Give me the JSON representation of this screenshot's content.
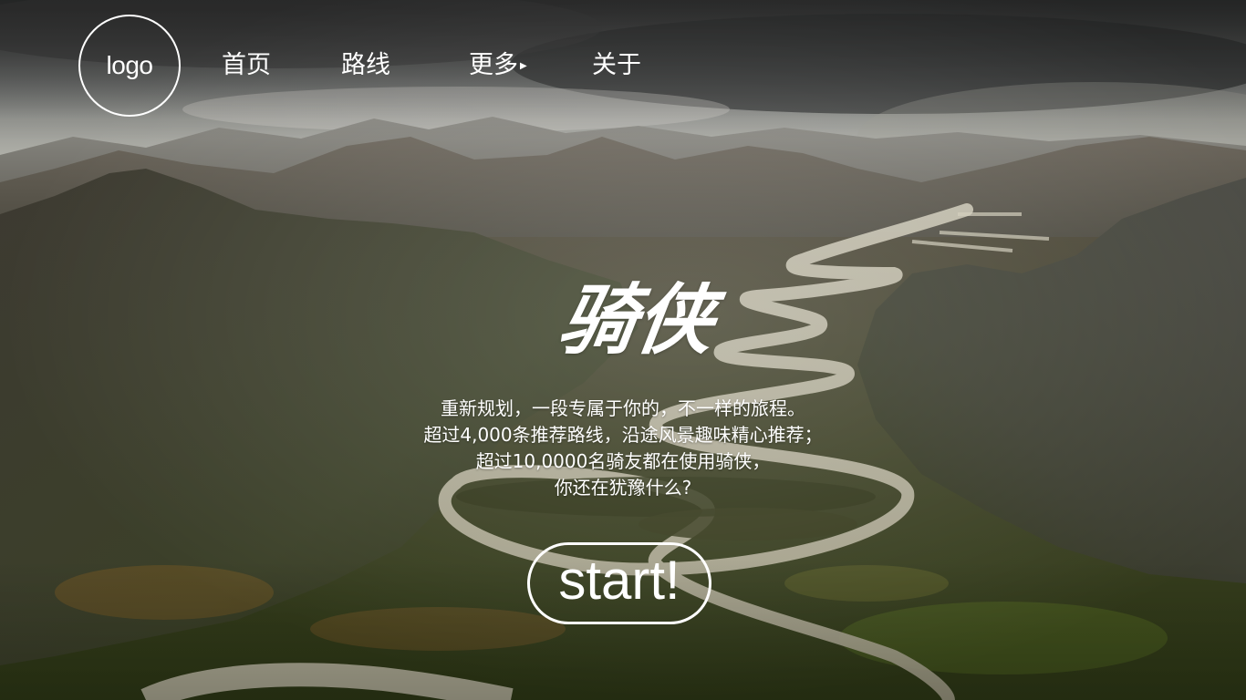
{
  "header": {
    "logo_text": "logo",
    "nav": [
      {
        "label": "首页"
      },
      {
        "label": "路线"
      },
      {
        "label": "更多",
        "has_dropdown": true,
        "caret_icon": "caret-right-icon"
      },
      {
        "label": "关于"
      }
    ]
  },
  "hero": {
    "title": "骑侠",
    "lines": [
      "重新规划，一段专属于你的，不一样的旅程。",
      "超过4,000条推荐路线，沿途风景趣味精心推荐；",
      "超过10,0000名骑友都在使用骑侠，",
      "你还在犹豫什么?"
    ],
    "cta_label": "start!"
  },
  "background": {
    "subject": "aerial mountain valley with winding river",
    "colors": {
      "sky": "#8a8c8a",
      "cloud_dark": "#3e3f3f",
      "mountain": "#4a4a40",
      "river": "#b9b3a0",
      "forest": "#3f4a22",
      "autumn": "#8a6a2a"
    }
  }
}
